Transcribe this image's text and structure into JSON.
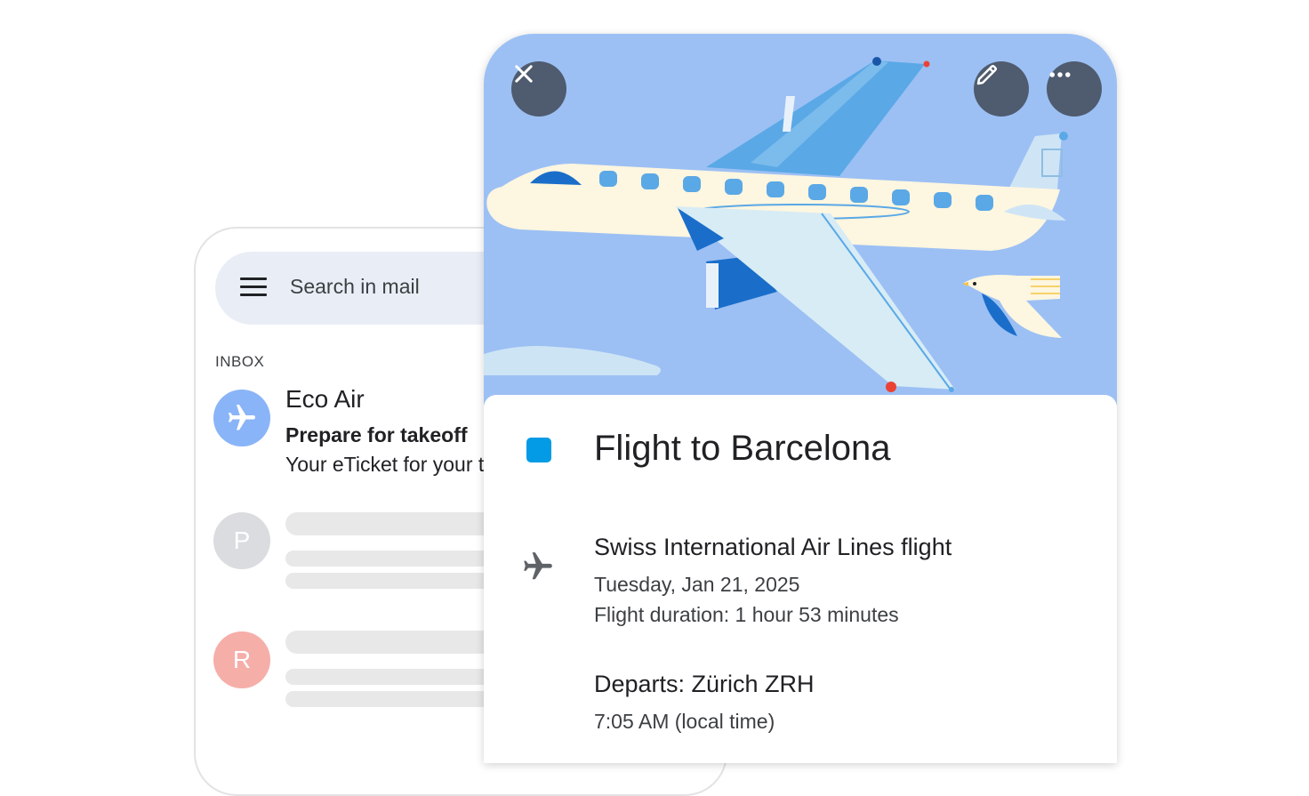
{
  "mail": {
    "search_placeholder": "Search in mail",
    "inbox_label": "INBOX",
    "messages": [
      {
        "avatar": "airplane-icon",
        "avatar_color": "#8ab4f8",
        "sender": "Eco Air",
        "subject": "Prepare for takeoff",
        "snippet": "Your eTicket for your t"
      },
      {
        "avatar_letter": "P",
        "avatar_color": "#dadce0"
      },
      {
        "avatar_letter": "R",
        "avatar_color": "#f6aea9"
      }
    ]
  },
  "event": {
    "title": "Flight to Barcelona",
    "color": "#039be5",
    "airline": "Swiss International Air Lines flight",
    "date": "Tuesday, Jan 21, 2025",
    "duration": "Flight duration: 1 hour 53 minutes",
    "departs": "Departs: Zürich ZRH",
    "departs_time": "7:05 AM (local time)"
  },
  "icons": {
    "close": "close-icon",
    "edit": "pencil-icon",
    "more": "more-horizontal-icon",
    "menu": "hamburger-menu-icon",
    "flight": "airplane-icon"
  },
  "colors": {
    "hero_background": "#9cc0f4",
    "action_button": "#4f5b6e"
  }
}
